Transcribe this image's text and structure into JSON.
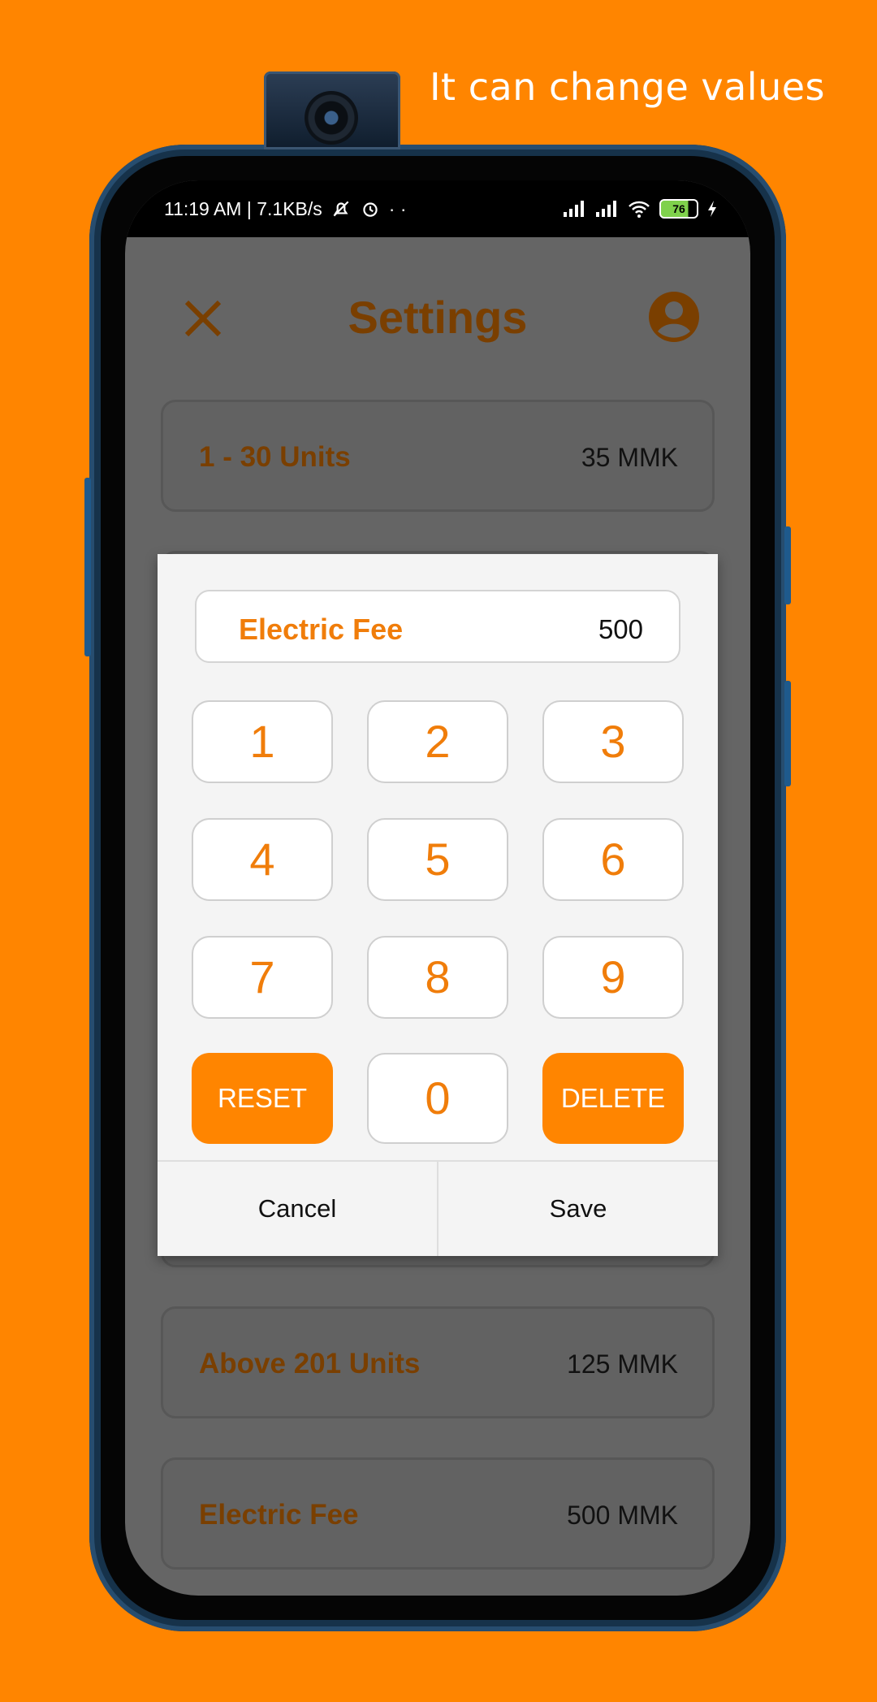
{
  "promo": {
    "caption": "It can change values"
  },
  "status_bar": {
    "left_text": "11:19 AM | 7.1KB/s",
    "dots": "· ·",
    "battery": "76"
  },
  "header": {
    "title": "Settings"
  },
  "rates": [
    {
      "label": "1 - 30 Units",
      "value": "35 MMK"
    },
    {
      "label": "",
      "value": ""
    },
    {
      "label": "",
      "value": ""
    },
    {
      "label": "",
      "value": ""
    },
    {
      "label": "",
      "value": ""
    },
    {
      "label": "",
      "value": ""
    },
    {
      "label": "Above 201 Units",
      "value": "125 MMK"
    },
    {
      "label": "Electric Fee",
      "value": "500 MMK"
    }
  ],
  "dialog": {
    "field_label": "Electric Fee",
    "field_value": "500",
    "keys": [
      "1",
      "2",
      "3",
      "4",
      "5",
      "6",
      "7",
      "8",
      "9"
    ],
    "reset_label": "RESET",
    "zero_label": "0",
    "delete_label": "DELETE",
    "cancel_label": "Cancel",
    "save_label": "Save"
  },
  "colors": {
    "accent": "#ff8500",
    "accent_text": "#f07d0a",
    "dim_label": "#7a3f00"
  }
}
